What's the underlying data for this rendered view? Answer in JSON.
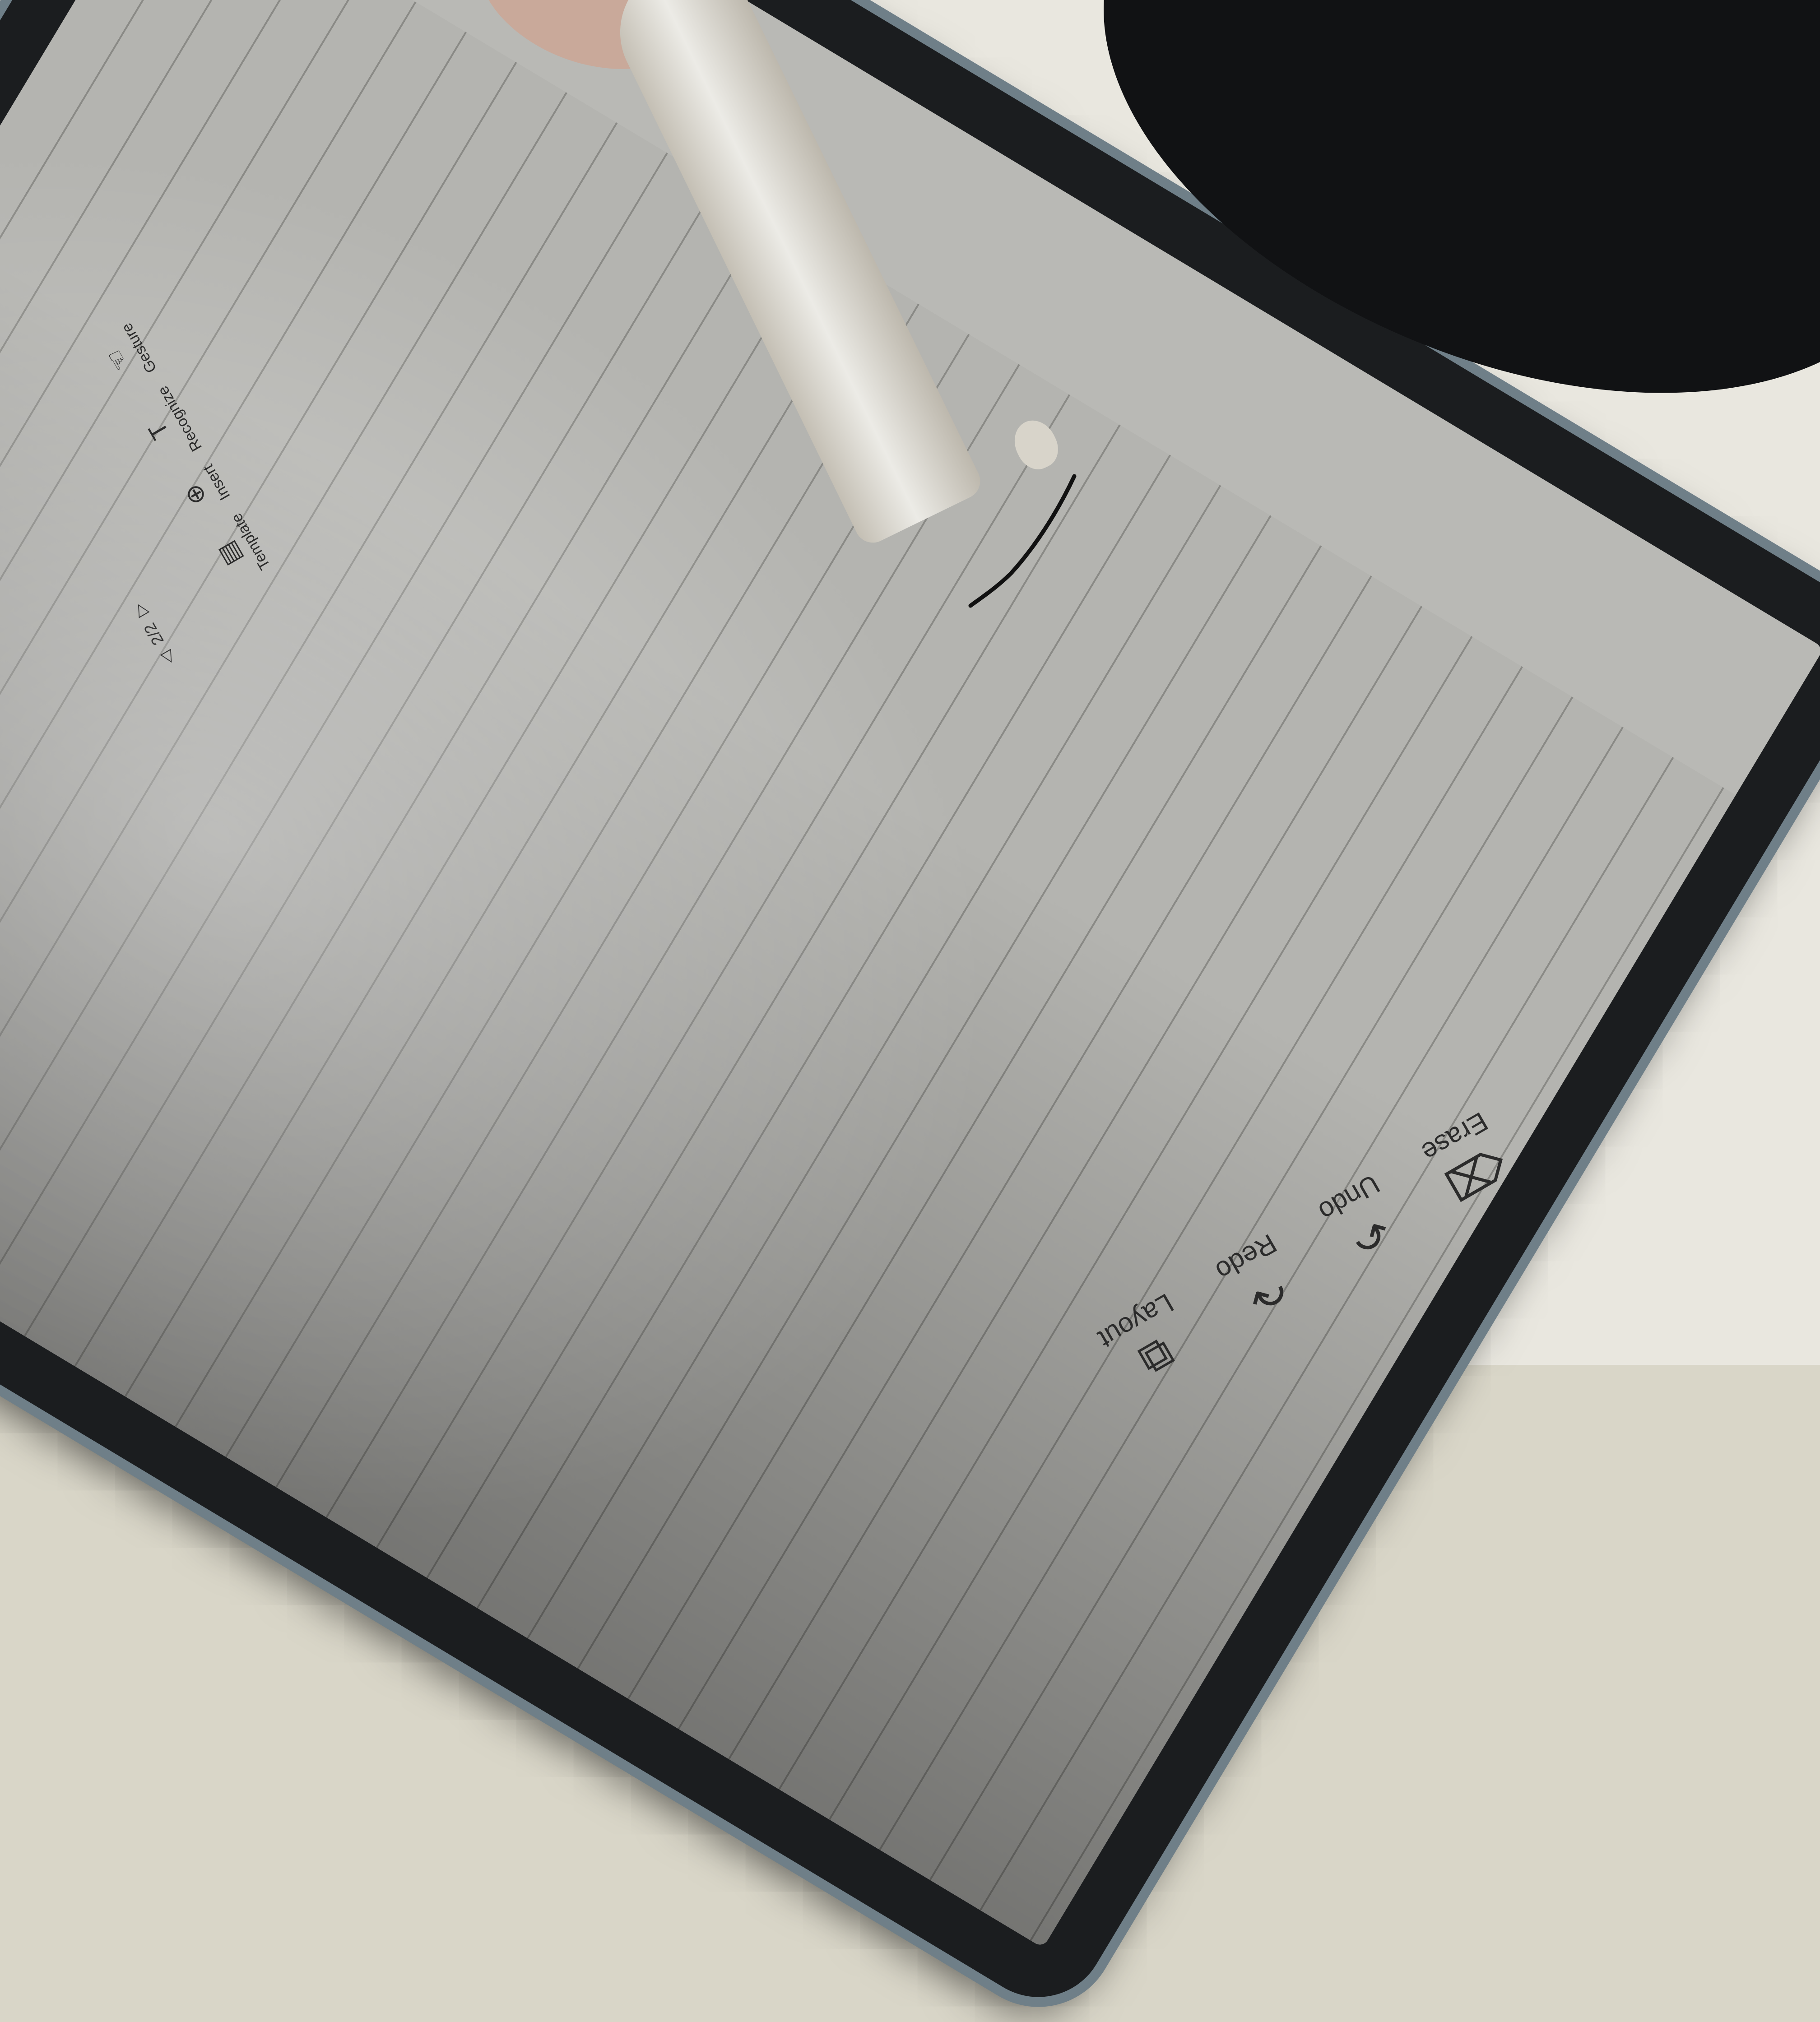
{
  "toolbar": {
    "items": [
      {
        "label": "Template",
        "icon": "template-icon"
      },
      {
        "label": "Insert",
        "icon": "insert-icon"
      },
      {
        "label": "Recognize",
        "icon": "recognize-icon"
      },
      {
        "label": "Gesture",
        "icon": "gesture-icon"
      }
    ],
    "page_counter": "2/2"
  },
  "bottom_toolbar": {
    "items": [
      {
        "label": "Erase",
        "icon": "eraser-icon"
      },
      {
        "label": "Undo",
        "icon": "undo-icon"
      },
      {
        "label": "Redo",
        "icon": "redo-icon"
      },
      {
        "label": "Layout",
        "icon": "layout-icon"
      }
    ]
  },
  "colors": {
    "screen": "#b9b9b5",
    "ruled_line": "#8a8a86",
    "ink": "#111111",
    "bezel": "#1b1d1f",
    "fabric_light": "#e9e7df",
    "fabric_olive": "#b8b294"
  }
}
